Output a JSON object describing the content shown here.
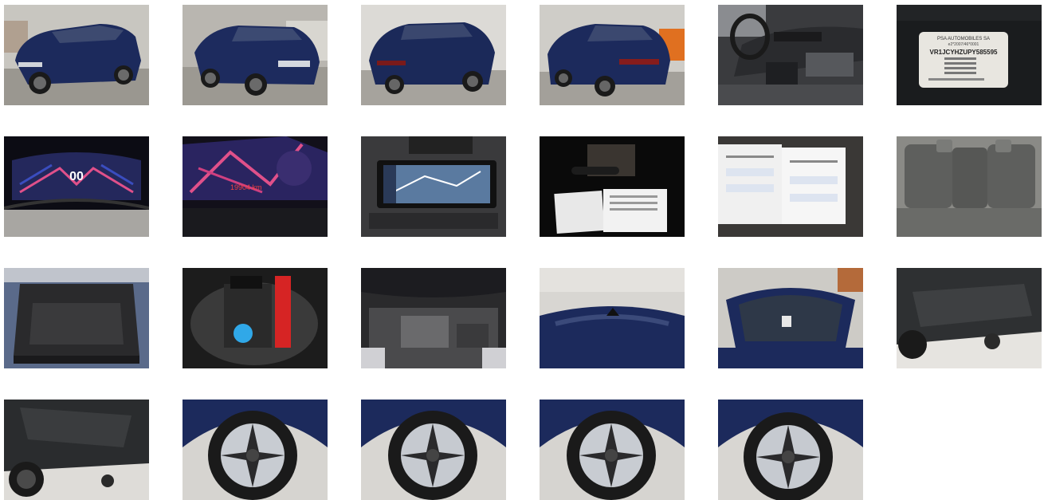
{
  "gallery": {
    "photos": [
      {
        "subject": "front-left exterior"
      },
      {
        "subject": "front-right exterior"
      },
      {
        "subject": "rear-left exterior"
      },
      {
        "subject": "rear-right exterior"
      },
      {
        "subject": "dashboard interior"
      },
      {
        "subject": "vin plate"
      },
      {
        "subject": "instrument cluster"
      },
      {
        "subject": "instrument cluster odometer"
      },
      {
        "subject": "infotainment screen"
      },
      {
        "subject": "keys and manuals"
      },
      {
        "subject": "service documents"
      },
      {
        "subject": "rear seats"
      },
      {
        "subject": "trunk"
      },
      {
        "subject": "spare wheel well"
      },
      {
        "subject": "engine bay"
      },
      {
        "subject": "roof"
      },
      {
        "subject": "windshield"
      },
      {
        "subject": "underbody front"
      },
      {
        "subject": "underbody rear"
      },
      {
        "subject": "wheel front-left"
      },
      {
        "subject": "wheel front-right"
      },
      {
        "subject": "wheel rear-left"
      },
      {
        "subject": "wheel rear-right"
      }
    ]
  },
  "vin_plate": {
    "line1": "PSA AUTOMOBILES SA",
    "line2": "e2*2007/46*0001",
    "vin": "VR1JCYHZUPY585595"
  },
  "cluster": {
    "speed": "00",
    "odometer": "19904 km"
  },
  "colors": {
    "car_blue": "#1c2a5c",
    "floor_gray": "#9a9790",
    "wall_gray": "#c9c7c2",
    "cluster_pink": "#e0508a",
    "cluster_blue": "#3a4dbf"
  }
}
